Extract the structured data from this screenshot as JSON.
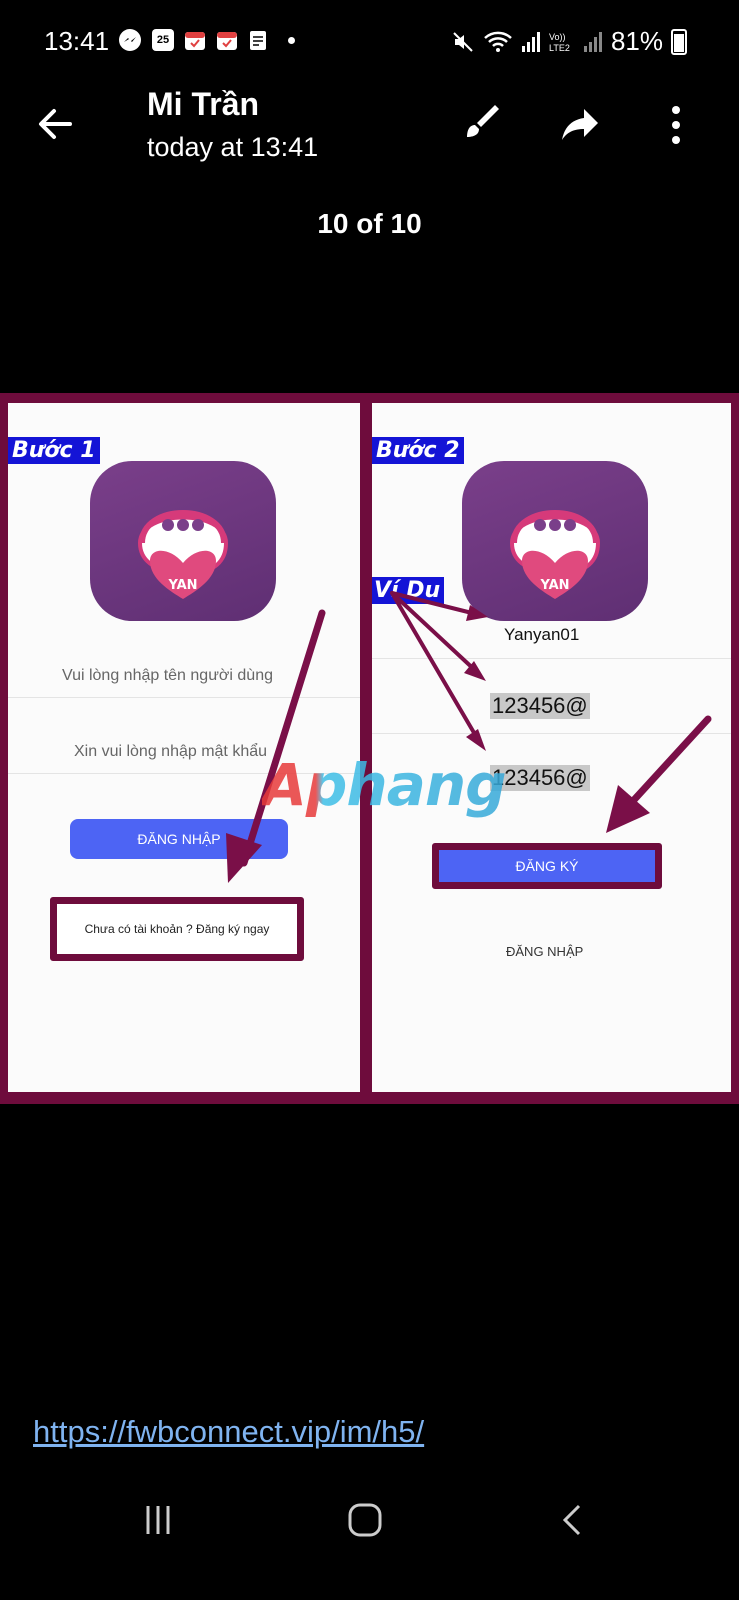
{
  "status_bar": {
    "time": "13:41",
    "calendar_day": "25",
    "battery": "81%"
  },
  "header": {
    "title": "Mi Trần",
    "subtitle": "today at 13:41",
    "counter": "10 of 10"
  },
  "image": {
    "left_panel": {
      "step_label": "Bước 1",
      "logo_text": "YAN",
      "username_placeholder": "Vui lòng nhập tên người dùng",
      "password_placeholder": "Xin vui lòng nhập mật khẩu",
      "login_button": "ĐĂNG NHẬP",
      "register_link": "Chưa có tài khoản ? Đăng ký ngay"
    },
    "right_panel": {
      "step_label": "Bước 2",
      "example_label": "Ví Du",
      "logo_text": "YAN",
      "username_value": "Yanyan01",
      "password_value": "123456@",
      "confirm_value": "123456@",
      "register_button": "ĐĂNG KÝ",
      "login_link": "ĐĂNG NHẬP"
    },
    "watermark": "Aphang",
    "frame_color": "#6e0c3c",
    "button_color": "#4d64f4"
  },
  "caption_link": "https://fwbconnect.vip/im/h5/",
  "icons": {
    "back": "arrow-left-icon",
    "edit": "brush-icon",
    "share": "share-icon",
    "more": "more-vertical-icon",
    "nav_recent": "recent-apps-icon",
    "nav_home": "home-icon",
    "nav_back": "nav-back-icon"
  }
}
